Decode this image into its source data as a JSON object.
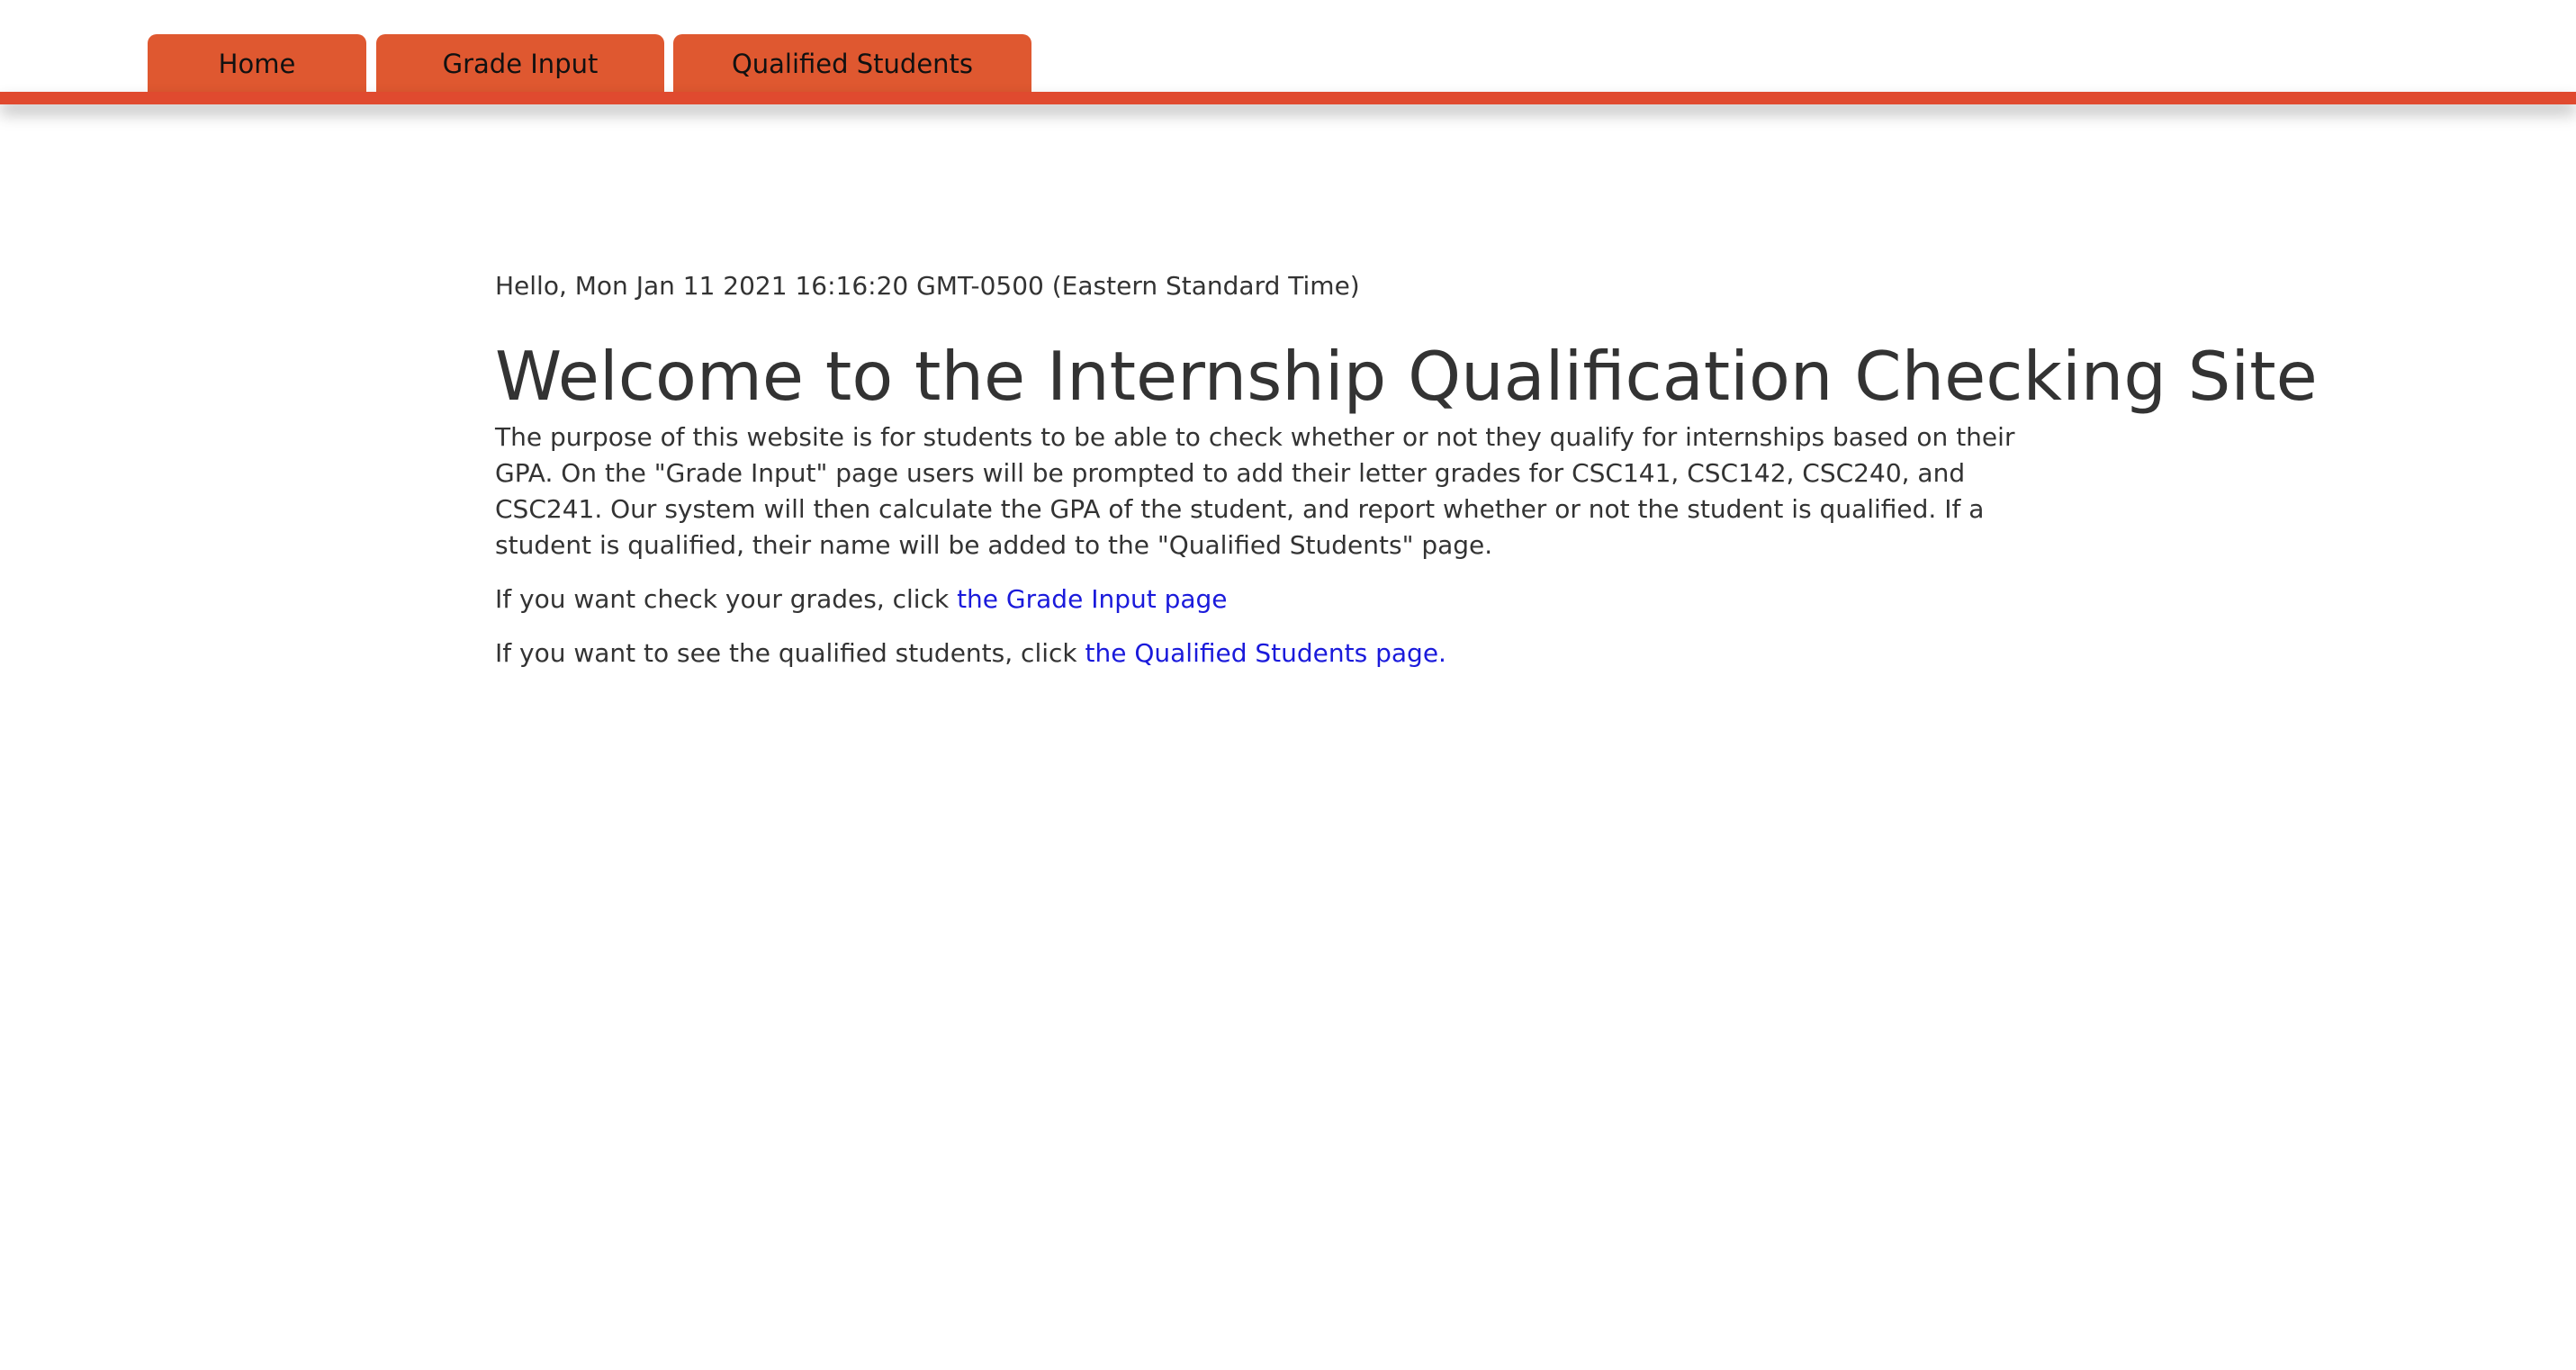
{
  "nav": {
    "tabs": [
      {
        "label": "Home"
      },
      {
        "label": "Grade Input"
      },
      {
        "label": "Qualified Students"
      }
    ]
  },
  "main": {
    "greeting": "Hello, Mon Jan 11 2021 16:16:20 GMT-0500 (Eastern Standard Time)",
    "title": "Welcome to the Internship Qualification Checking Site",
    "purpose": "The purpose of this website is for students to be able to check whether or not they qualify for internships based on their GPA. On the \"Grade Input\" page users will be prompted to add their letter grades for CSC141, CSC142, CSC240, and CSC241. Our system will then calculate the GPA of the student, and report whether or not the student is qualified. If a student is qualified, their name will be added to the \"Qualified Students\" page.",
    "grade_line": {
      "prefix": "If you want check your grades, click ",
      "link": "the Grade Input page"
    },
    "qualified_line": {
      "prefix": "If you want to see the qualified students, click ",
      "link": "the Qualified Students page."
    }
  },
  "colors": {
    "accent": "#df5830",
    "nav_line": "#e04a2f",
    "link": "#1a1adb",
    "text": "#333333"
  }
}
